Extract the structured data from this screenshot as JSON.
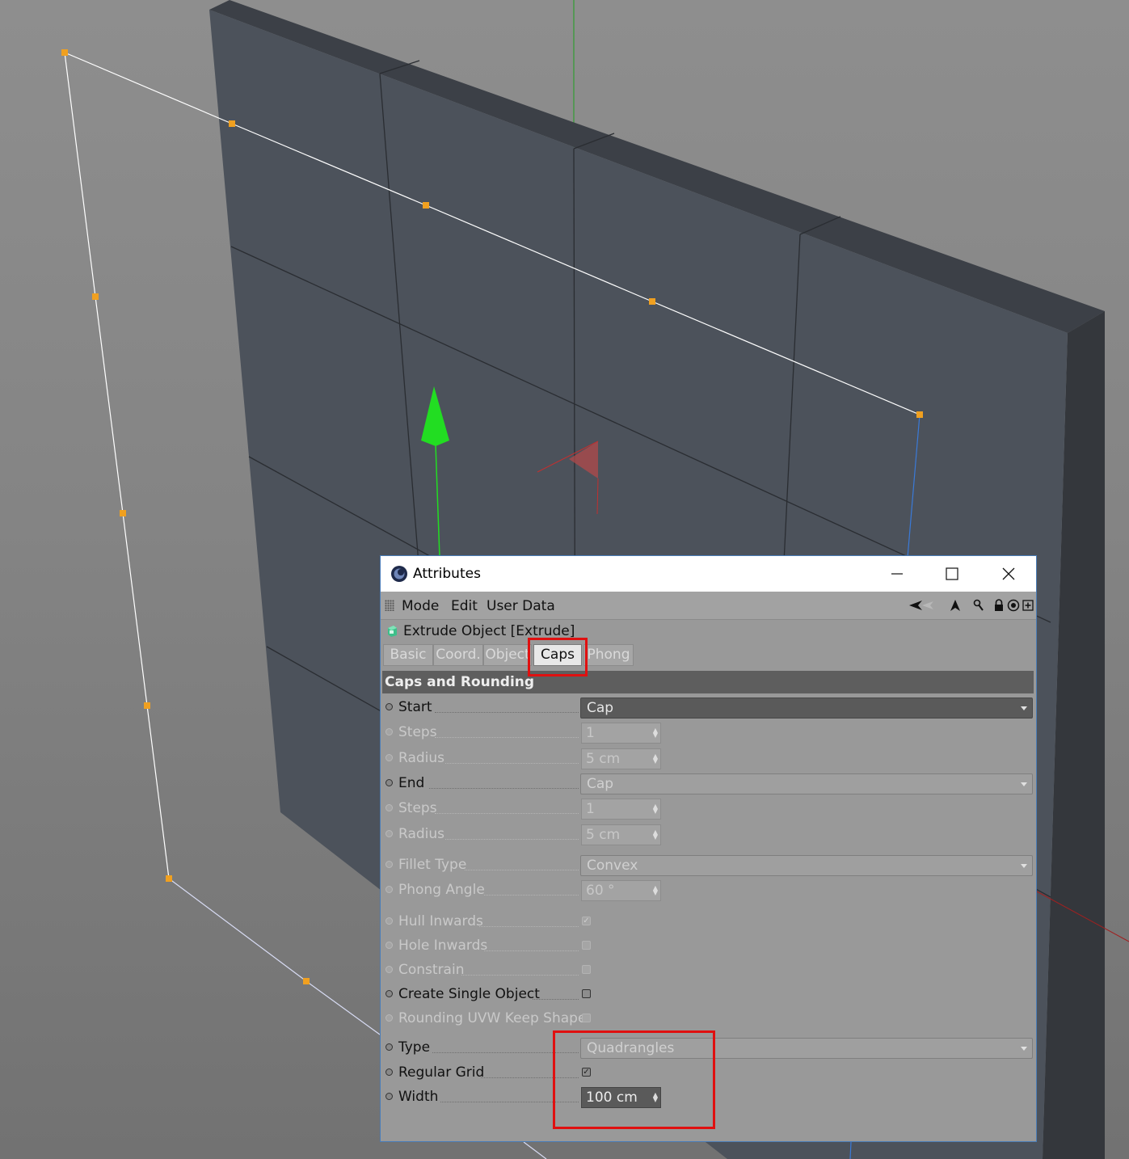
{
  "window": {
    "title": "Attributes",
    "minimize_glyph": "–",
    "maximize_glyph": "☐",
    "close_glyph": "✕"
  },
  "menu": {
    "items": [
      "Mode",
      "Edit",
      "User Data"
    ]
  },
  "toolbar_icons": [
    "back-arrow-icon",
    "up-arrow-icon",
    "search-icon",
    "lock-icon",
    "target-icon",
    "add-panel-icon"
  ],
  "object": {
    "title": "Extrude Object [Extrude]"
  },
  "tabs": [
    {
      "label": "Basic",
      "active": false
    },
    {
      "label": "Coord.",
      "active": false
    },
    {
      "label": "Object",
      "active": false
    },
    {
      "label": "Caps",
      "active": true
    },
    {
      "label": "Phong",
      "active": false
    }
  ],
  "section": {
    "title": "Caps and Rounding"
  },
  "params": {
    "start": {
      "label": "Start",
      "value": "Cap"
    },
    "start_steps": {
      "label": "Steps",
      "value": "1"
    },
    "start_radius": {
      "label": "Radius",
      "value": "5 cm"
    },
    "end": {
      "label": "End",
      "value": "Cap"
    },
    "end_steps": {
      "label": "Steps",
      "value": "1"
    },
    "end_radius": {
      "label": "Radius",
      "value": "5 cm"
    },
    "fillet_type": {
      "label": "Fillet Type",
      "value": "Convex"
    },
    "phong_angle": {
      "label": "Phong Angle",
      "value": "60 °"
    },
    "hull_inwards": {
      "label": "Hull Inwards",
      "checked": true
    },
    "hole_inwards": {
      "label": "Hole Inwards",
      "checked": false
    },
    "constrain": {
      "label": "Constrain",
      "checked": false
    },
    "create_single_object": {
      "label": "Create Single Object",
      "checked": false
    },
    "rounding_uvw": {
      "label": "Rounding UVW Keep Shape",
      "checked": false
    },
    "type": {
      "label": "Type",
      "value": "Quadrangles"
    },
    "regular_grid": {
      "label": "Regular Grid",
      "checked": true
    },
    "width": {
      "label": "Width",
      "value": "100 cm"
    }
  },
  "colors": {
    "highlight": "#e01010",
    "viewport_bg": "#858585",
    "mesh_face": "#4c525b",
    "spline": "#ffffff",
    "points": "#f0a020",
    "y_axis": "#22dd22"
  }
}
